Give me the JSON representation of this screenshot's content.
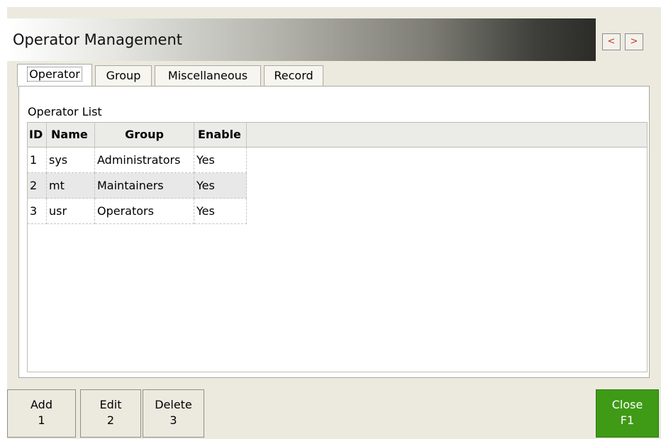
{
  "window": {
    "title": "Operator Management",
    "nav_prev": "<",
    "nav_next": ">"
  },
  "tabs": [
    {
      "label": "Operator",
      "active": true
    },
    {
      "label": "Group",
      "active": false
    },
    {
      "label": "Miscellaneous",
      "active": false
    },
    {
      "label": "Record",
      "active": false
    }
  ],
  "operator_list": {
    "label": "Operator List",
    "columns": [
      "ID",
      "Name",
      "Group",
      "Enable"
    ],
    "rows": [
      {
        "id": "1",
        "name": "sys",
        "group": "Administrators",
        "enable": "Yes"
      },
      {
        "id": "2",
        "name": "mt",
        "group": "Maintainers",
        "enable": "Yes"
      },
      {
        "id": "3",
        "name": "usr",
        "group": "Operators",
        "enable": "Yes"
      }
    ]
  },
  "buttons": {
    "add": {
      "label": "Add",
      "key": "1"
    },
    "edit": {
      "label": "Edit",
      "key": "2"
    },
    "delete": {
      "label": "Delete",
      "key": "3"
    },
    "close": {
      "label": "Close",
      "key": "F1"
    }
  },
  "colors": {
    "background": "#eceadf",
    "close_button": "#3f9a16",
    "nav_arrow": "#c23a2a"
  }
}
